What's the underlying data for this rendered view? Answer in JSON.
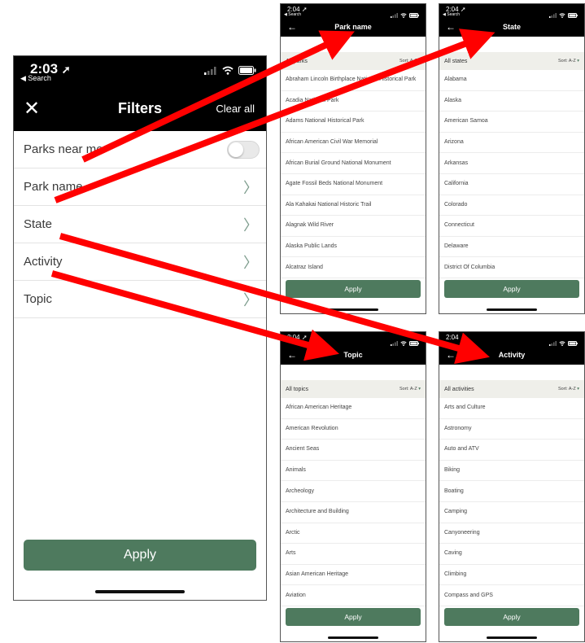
{
  "main": {
    "time": "2:03",
    "back_app": "◀ Search",
    "title": "Filters",
    "clear_all": "Clear all",
    "rows": [
      {
        "label": "Parks near me"
      },
      {
        "label": "Park name"
      },
      {
        "label": "State"
      },
      {
        "label": "Activity"
      },
      {
        "label": "Topic"
      }
    ],
    "apply": "Apply"
  },
  "park": {
    "time": "2:04",
    "back_app": "◀ Search",
    "title": "Park name",
    "list_header": "All parks",
    "sort": "Sort: A-Z",
    "items": [
      "Abraham Lincoln Birthplace National Historical Park",
      "Acadia National Park",
      "Adams National Historical Park",
      "African American Civil War Memorial",
      "African Burial Ground National Monument",
      "Agate Fossil Beds National Monument",
      "Ala Kahakai National Historic Trail",
      "Alagnak Wild River",
      "Alaska Public Lands",
      "Alcatraz Island"
    ],
    "apply": "Apply"
  },
  "state": {
    "time": "2:04",
    "back_app": "◀ Search",
    "title": "State",
    "list_header": "All states",
    "sort": "Sort: A-Z",
    "items": [
      "Alabama",
      "Alaska",
      "American Samoa",
      "Arizona",
      "Arkansas",
      "California",
      "Colorado",
      "Connecticut",
      "Delaware",
      "District Of Columbia"
    ],
    "apply": "Apply"
  },
  "topic": {
    "time": "2:04",
    "title": "Topic",
    "list_header": "All topics",
    "sort": "Sort: A-Z",
    "items": [
      "African American Heritage",
      "American Revolution",
      "Ancient Seas",
      "Animals",
      "Archeology",
      "Architecture and Building",
      "Arctic",
      "Arts",
      "Asian American Heritage",
      "Aviation"
    ],
    "apply": "Apply"
  },
  "activity": {
    "time": "2:04",
    "title": "Activity",
    "list_header": "All activities",
    "sort": "Sort: A-Z",
    "items": [
      "Arts and Culture",
      "Astronomy",
      "Auto and ATV",
      "Biking",
      "Boating",
      "Camping",
      "Canyoneering",
      "Caving",
      "Climbing",
      "Compass and GPS"
    ],
    "apply": "Apply"
  },
  "colors": {
    "accent": "#4e7a5e",
    "arrow": "#ff0000",
    "navbar": "#000000"
  },
  "icons": [
    "location-arrow-icon",
    "signal-icon",
    "wifi-icon",
    "battery-icon",
    "close-icon",
    "chevron-right-icon",
    "back-arrow-icon"
  ]
}
